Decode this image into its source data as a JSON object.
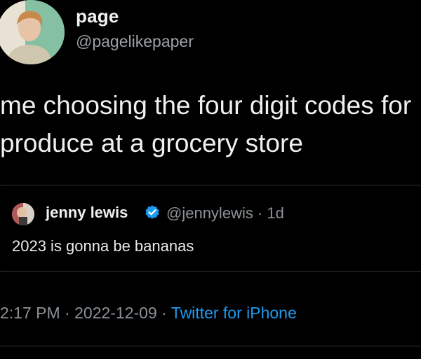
{
  "tweet": {
    "author": {
      "display_name": "page",
      "handle": "@pagelikepaper"
    },
    "text_lines": [
      "me choosing the four digit codes for",
      "produce at a grocery store"
    ],
    "quoted": {
      "display_name": "jenny lewis",
      "verified_icon": "verified-badge-icon",
      "handle_time": "@jennylewis · 1d",
      "text": "2023 is gonna be bananas"
    },
    "meta": {
      "time": "2:17 PM",
      "separator": " · ",
      "date": "2022-12-09",
      "source": "Twitter for iPhone"
    }
  },
  "colors": {
    "background": "#000000",
    "text": "#e7e9ea",
    "secondary": "#8b9196",
    "link": "#1d9bf0",
    "border": "#2f3336",
    "verified": "#1d9bf0"
  }
}
